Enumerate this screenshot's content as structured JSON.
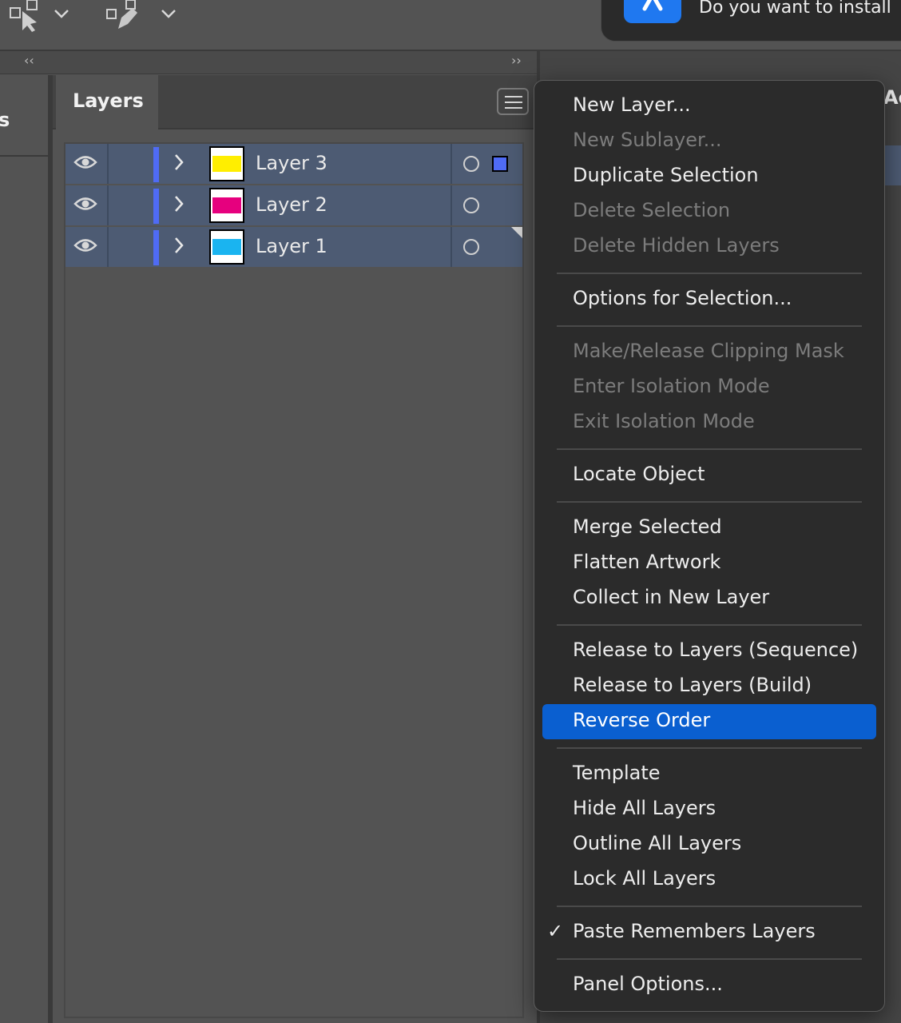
{
  "notification": {
    "text": "Do you want to install"
  },
  "left_panel": {
    "tab_stub": "s"
  },
  "right_panel": {
    "tab_stub": "Ac"
  },
  "layers_panel": {
    "tab_label": "Layers",
    "layers": [
      {
        "name": "Layer 3",
        "color": "#ffee00",
        "selected_art": true
      },
      {
        "name": "Layer 2",
        "color": "#e6007e",
        "selected_art": false
      },
      {
        "name": "Layer 1",
        "color": "#1ab4f0",
        "selected_art": false
      }
    ]
  },
  "menu": {
    "items": [
      {
        "label": "New Layer...",
        "enabled": true
      },
      {
        "label": "New Sublayer...",
        "enabled": false
      },
      {
        "label": "Duplicate Selection",
        "enabled": true
      },
      {
        "label": "Delete Selection",
        "enabled": false
      },
      {
        "label": "Delete Hidden Layers",
        "enabled": false
      },
      {
        "label": "Options for Selection...",
        "enabled": true
      },
      {
        "label": "Make/Release Clipping Mask",
        "enabled": false
      },
      {
        "label": "Enter Isolation Mode",
        "enabled": false
      },
      {
        "label": "Exit Isolation Mode",
        "enabled": false
      },
      {
        "label": "Locate Object",
        "enabled": true
      },
      {
        "label": "Merge Selected",
        "enabled": true
      },
      {
        "label": "Flatten Artwork",
        "enabled": true
      },
      {
        "label": "Collect in New Layer",
        "enabled": true
      },
      {
        "label": "Release to Layers (Sequence)",
        "enabled": true
      },
      {
        "label": "Release to Layers (Build)",
        "enabled": true
      },
      {
        "label": "Reverse Order",
        "enabled": true,
        "highlighted": true
      },
      {
        "label": "Template",
        "enabled": true
      },
      {
        "label": "Hide All Layers",
        "enabled": true
      },
      {
        "label": "Outline All Layers",
        "enabled": true
      },
      {
        "label": "Lock All Layers",
        "enabled": true
      },
      {
        "label": "Paste Remembers Layers",
        "enabled": true,
        "checked": true,
        "check_mark": "✓"
      },
      {
        "label": "Panel Options...",
        "enabled": true
      }
    ]
  },
  "colors": {
    "highlight": "#0a5fd0",
    "selection_bar": "#4f6bf5",
    "row_selected": "#4d5b73"
  }
}
